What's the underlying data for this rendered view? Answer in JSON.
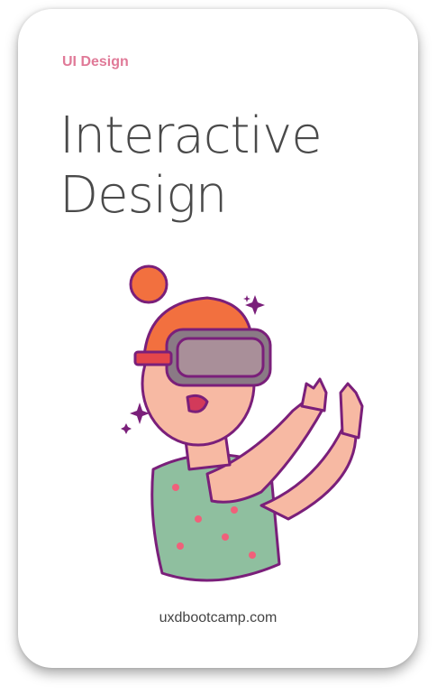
{
  "card": {
    "category": "UI Design",
    "title_line1": "Interactive",
    "title_line2": "Design",
    "illustration": "person-wearing-vr-headset",
    "footer": "uxdbootcamp.com"
  },
  "colors": {
    "category": "#e07a98",
    "title": "#4a4a4a",
    "hair": "#f2703f",
    "skin": "#f7b9a3",
    "shirt": "#8fbf9f",
    "outline": "#7a1f7a"
  }
}
